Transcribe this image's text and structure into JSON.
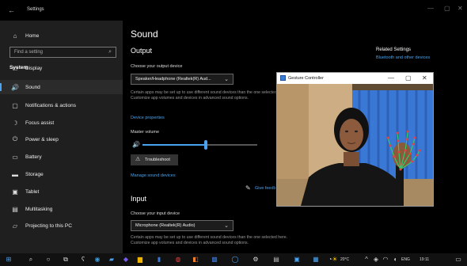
{
  "settings": {
    "title": "Settings",
    "search_placeholder": "Find a setting",
    "home_label": "Home",
    "section_label": "System",
    "nav": [
      {
        "label": "Display",
        "icon": "display-icon",
        "glyph": "▭"
      },
      {
        "label": "Sound",
        "icon": "sound-icon",
        "glyph": "🔊"
      },
      {
        "label": "Notifications & actions",
        "icon": "notifications-icon",
        "glyph": "▢"
      },
      {
        "label": "Focus assist",
        "icon": "focus-assist-icon",
        "glyph": "☽"
      },
      {
        "label": "Power & sleep",
        "icon": "power-icon",
        "glyph": "⏻"
      },
      {
        "label": "Battery",
        "icon": "battery-icon",
        "glyph": "▭"
      },
      {
        "label": "Storage",
        "icon": "storage-icon",
        "glyph": "▬"
      },
      {
        "label": "Tablet",
        "icon": "tablet-icon",
        "glyph": "▣"
      },
      {
        "label": "Multitasking",
        "icon": "multitasking-icon",
        "glyph": "▤"
      },
      {
        "label": "Projecting to this PC",
        "icon": "projecting-icon",
        "glyph": "▱"
      }
    ],
    "active_nav": "Sound"
  },
  "sound": {
    "title": "Sound",
    "output_heading": "Output",
    "output_device_label": "Choose your output device",
    "output_device_value": "Speaker/Headphone (Realtek(R) Aud...",
    "output_desc": "Certain apps may be set up to use different sound devices than the one selected here. Customize app volumes and devices in advanced sound options.",
    "device_properties_link": "Device properties",
    "master_volume_label": "Master volume",
    "master_volume_level": 0.55,
    "troubleshoot_label": "Troubleshoot",
    "manage_devices_link": "Manage sound devices",
    "input_heading": "Input",
    "input_device_label": "Choose your input device",
    "input_device_value": "Microphone (Realtek(R) Audio)",
    "input_desc": "Certain apps may be set up to use different sound devices than the one selected here. Customize app volumes and devices in advanced sound options."
  },
  "related": {
    "heading": "Related Settings",
    "link1": "Bluetooth and other devices",
    "feedback_link": "Give feedback"
  },
  "gesture_window": {
    "title": "Gesture Controller"
  },
  "taskbar": {
    "weather": "20°C",
    "lang": "ENG",
    "time": "19:11"
  }
}
